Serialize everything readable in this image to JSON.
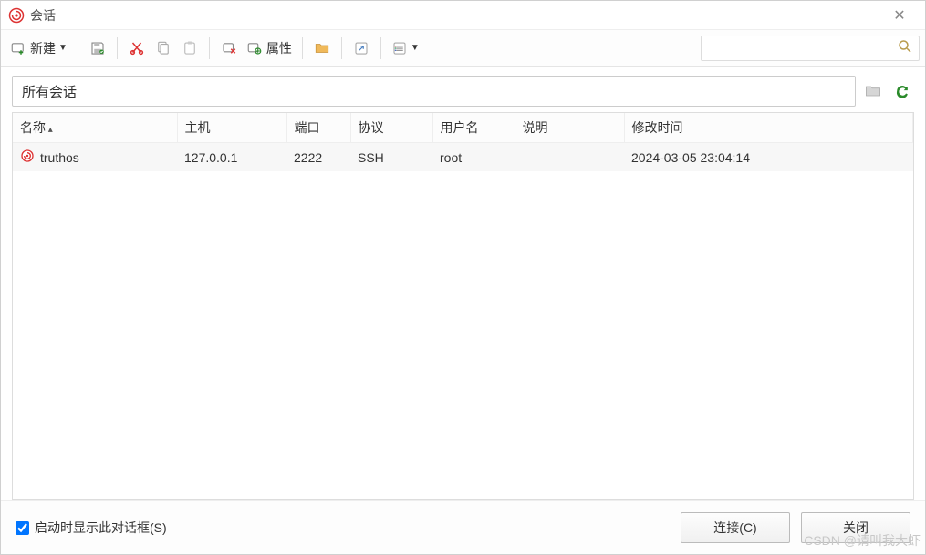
{
  "window": {
    "title": "会话"
  },
  "toolbar": {
    "new_label": "新建",
    "properties_label": "属性"
  },
  "search": {
    "placeholder": ""
  },
  "path": {
    "value": "所有会话"
  },
  "table": {
    "headers": {
      "name": "名称",
      "host": "主机",
      "port": "端口",
      "protocol": "协议",
      "user": "用户名",
      "desc": "说明",
      "modified": "修改时间"
    },
    "rows": [
      {
        "name": "truthos",
        "host": "127.0.0.1",
        "port": "2222",
        "protocol": "SSH",
        "user": "root",
        "desc": "",
        "modified": "2024-03-05 23:04:14"
      }
    ]
  },
  "footer": {
    "startup_label": "启动时显示此对话框(S)",
    "connect_label": "连接(C)",
    "close_label": "关闭"
  },
  "watermark": "CSDN @请叫我大虾"
}
